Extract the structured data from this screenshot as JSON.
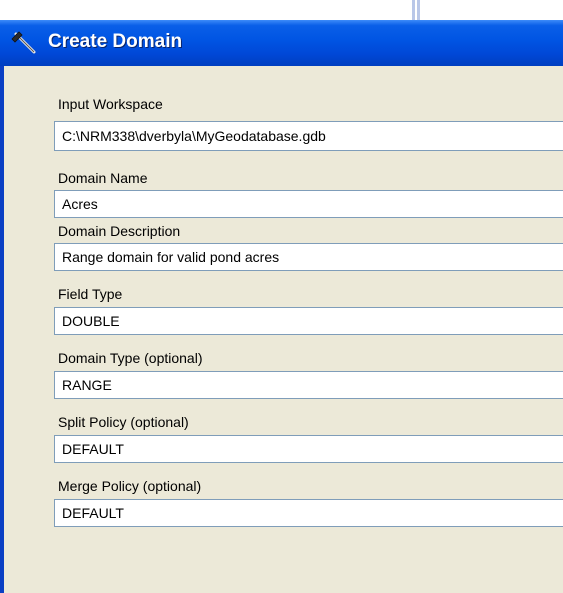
{
  "window": {
    "title": "Create Domain",
    "title_icon": "hammer-icon"
  },
  "parameters": [
    {
      "label": "Input Workspace",
      "value": "C:\\NRM338\\dverbyla\\MyGeodatabase.gdb"
    },
    {
      "label": "Domain Name",
      "value": "Acres"
    },
    {
      "label": "Domain Description",
      "value": "Range domain for valid pond acres"
    },
    {
      "label": "Field Type",
      "value": "DOUBLE"
    },
    {
      "label": "Domain Type (optional)",
      "value": "RANGE"
    },
    {
      "label": "Split Policy (optional)",
      "value": "DEFAULT"
    },
    {
      "label": "Merge Policy (optional)",
      "value": "DEFAULT"
    }
  ],
  "colors": {
    "titlebar": "#0054e3",
    "panel": "#ece9d8",
    "field_border": "#7f9db9"
  }
}
